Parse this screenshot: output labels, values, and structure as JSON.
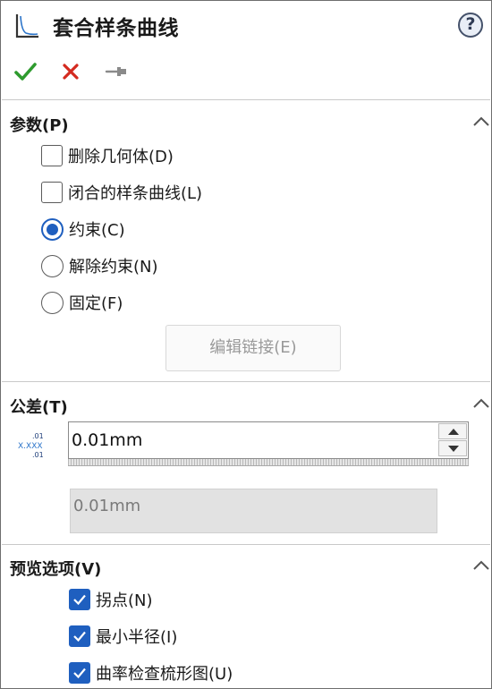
{
  "header": {
    "title": "套合样条曲线",
    "help_symbol": "?"
  },
  "actions": {
    "ok": "check-icon",
    "cancel": "close-icon",
    "pin": "pin-icon"
  },
  "params": {
    "title": "参数(P)",
    "delete_geometry": {
      "label": "删除几何体(D)",
      "checked": false
    },
    "closed_spline": {
      "label": "闭合的样条曲线(L)",
      "checked": false
    },
    "radios": [
      {
        "label": "约束(C)",
        "selected": true
      },
      {
        "label": "解除约束(N)",
        "selected": false
      },
      {
        "label": "固定(F)",
        "selected": false
      }
    ],
    "edit_link_button": "编辑链接(E)"
  },
  "tolerance": {
    "title": "公差(T)",
    "value": "0.01mm",
    "readonly_value": "0.01mm",
    "icon_main": "X.XXX",
    "icon_sup": ".01",
    "icon_sub": ".01"
  },
  "preview": {
    "title": "预览选项(V)",
    "options": [
      {
        "label": "拐点(N)",
        "checked": true
      },
      {
        "label": "最小半径(I)",
        "checked": true
      },
      {
        "label": "曲率检查梳形图(U)",
        "checked": true
      }
    ]
  },
  "colors": {
    "accent": "#1f5fbf",
    "ok_green": "#2e9b2e",
    "cancel_red": "#d42a1f"
  }
}
